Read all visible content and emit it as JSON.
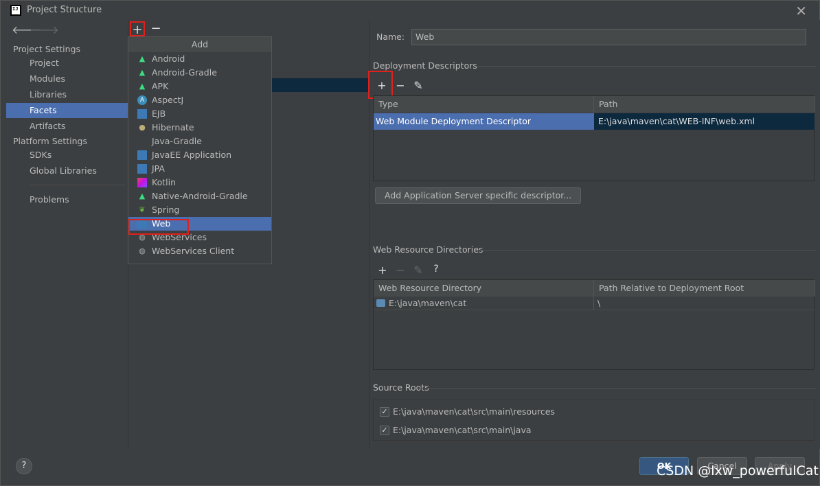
{
  "window": {
    "title": "Project Structure"
  },
  "sidebar": {
    "project_settings_header": "Project Settings",
    "project_settings_items": [
      "Project",
      "Modules",
      "Libraries",
      "Facets",
      "Artifacts"
    ],
    "platform_settings_header": "Platform Settings",
    "platform_settings_items": [
      "SDKs",
      "Global Libraries"
    ],
    "problems_label": "Problems",
    "selected": "Facets"
  },
  "middle": {
    "add_icon": "plus-icon",
    "remove_icon": "minus-icon"
  },
  "popup": {
    "title": "Add",
    "items": [
      {
        "label": "Android",
        "icon": "android-icon"
      },
      {
        "label": "Android-Gradle",
        "icon": "android-icon"
      },
      {
        "label": "APK",
        "icon": "android-icon"
      },
      {
        "label": "AspectJ",
        "icon": "aspectj-icon"
      },
      {
        "label": "EJB",
        "icon": "ejb-icon"
      },
      {
        "label": "Hibernate",
        "icon": "hibernate-icon"
      },
      {
        "label": "Java-Gradle",
        "icon": ""
      },
      {
        "label": "JavaEE Application",
        "icon": "javaee-icon"
      },
      {
        "label": "JPA",
        "icon": "jpa-icon"
      },
      {
        "label": "Kotlin",
        "icon": "kotlin-icon"
      },
      {
        "label": "Native-Android-Gradle",
        "icon": "android-icon"
      },
      {
        "label": "Spring",
        "icon": "spring-icon"
      },
      {
        "label": "Web",
        "icon": "web-icon"
      },
      {
        "label": "WebServices",
        "icon": "globe-icon"
      },
      {
        "label": "WebServices Client",
        "icon": "globe-icon"
      }
    ],
    "selected": "Web"
  },
  "right": {
    "name_label": "Name:",
    "name_value": "Web",
    "deployment_descriptors": {
      "title": "Deployment Descriptors",
      "columns": [
        "Type",
        "Path"
      ],
      "rows": [
        {
          "type": "Web Module Deployment Descriptor",
          "path": "E:\\java\\maven\\cat\\WEB-INF\\web.xml"
        }
      ],
      "add_server_button": "Add Application Server specific descriptor..."
    },
    "web_resource_directories": {
      "title": "Web Resource Directories",
      "help_label": "?",
      "columns": [
        "Web Resource Directory",
        "Path Relative to Deployment Root"
      ],
      "rows": [
        {
          "directory": "E:\\java\\maven\\cat",
          "relative": "\\"
        }
      ]
    },
    "source_roots": {
      "title": "Source Roots",
      "items": [
        {
          "path": "E:\\java\\maven\\cat\\src\\main\\resources",
          "checked": true
        },
        {
          "path": "E:\\java\\maven\\cat\\src\\main\\java",
          "checked": true
        }
      ]
    }
  },
  "footer": {
    "help_label": "?",
    "ok_label": "OK",
    "cancel_label": "Cancel",
    "apply_label": "Apply"
  },
  "watermark": "CSDN @lxw_powerfulCat",
  "colors": {
    "selection": "#4b6eaf",
    "highlight_frame": "#e0201c",
    "background": "#3c3f41"
  }
}
